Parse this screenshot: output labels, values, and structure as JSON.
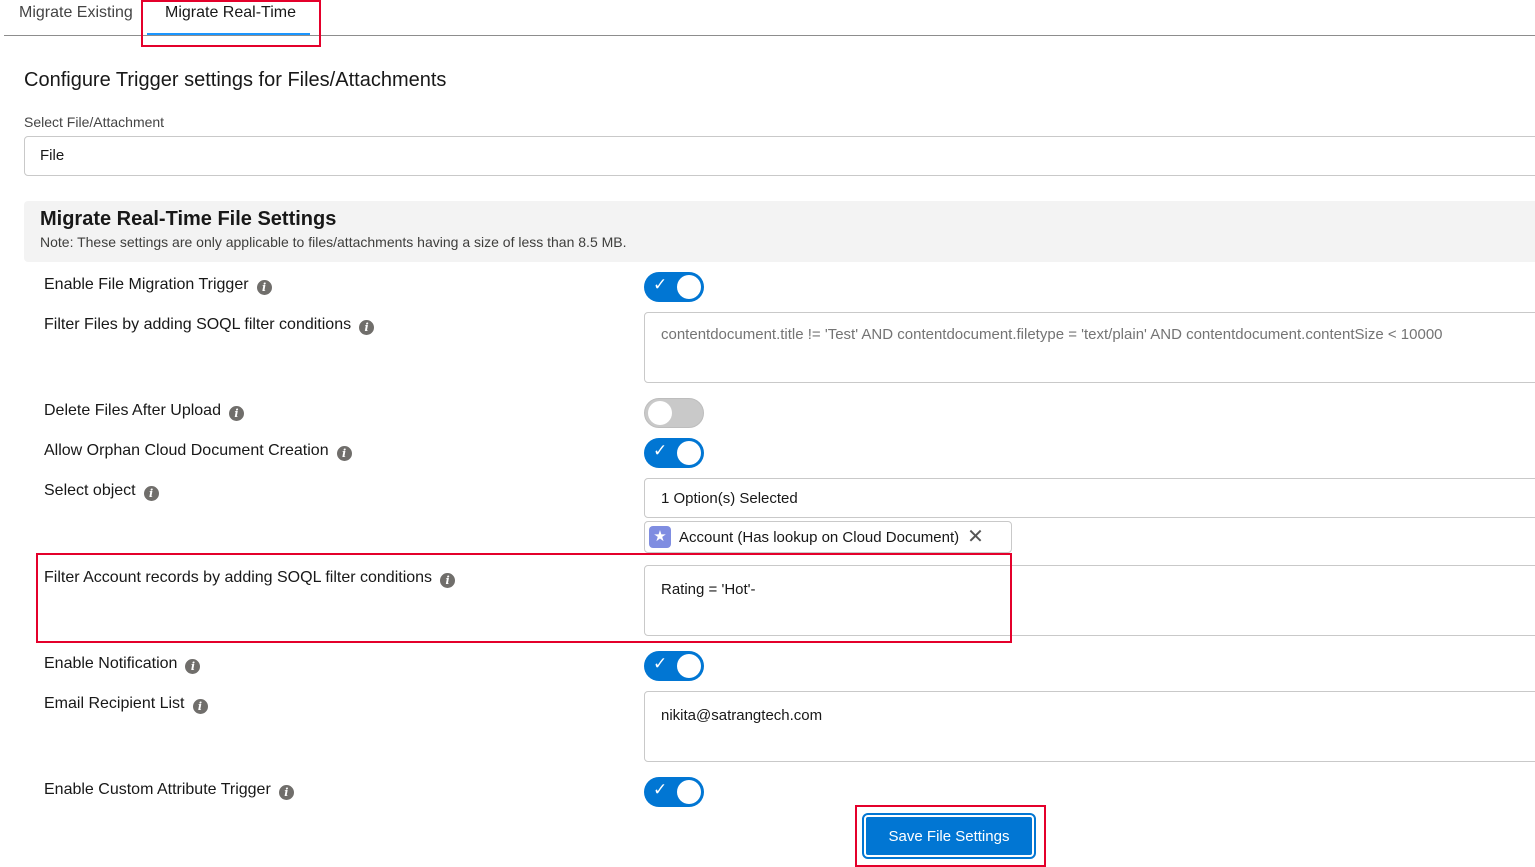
{
  "tabs": [
    {
      "label": "Migrate Existing",
      "active": false
    },
    {
      "label": "Migrate Real-Time",
      "active": true
    }
  ],
  "page_title": "Configure Trigger settings for Files/Attachments",
  "file_select": {
    "label": "Select File/Attachment",
    "value": "File"
  },
  "section": {
    "title": "Migrate Real-Time File Settings",
    "note": "Note: These settings are only applicable to files/attachments having a size of less than 8.5 MB."
  },
  "rows": {
    "enable_trigger": {
      "label": "Enable File Migration Trigger",
      "on": true
    },
    "filter_files": {
      "label": "Filter Files by adding SOQL filter conditions",
      "placeholder": "contentdocument.title != 'Test' AND contentdocument.filetype = 'text/plain' AND contentdocument.contentSize < 10000"
    },
    "delete_after": {
      "label": "Delete Files After Upload",
      "on": false
    },
    "allow_orphan": {
      "label": "Allow Orphan Cloud Document Creation",
      "on": true
    },
    "select_object": {
      "label": "Select object",
      "value": "1 Option(s) Selected",
      "selected_pill": "Account (Has lookup on Cloud Document)"
    },
    "filter_account": {
      "label": "Filter Account records by adding SOQL filter conditions",
      "value": "Rating = 'Hot'-"
    },
    "enable_notification": {
      "label": "Enable Notification",
      "on": true
    },
    "email_recipients": {
      "label": "Email Recipient List",
      "value": "nikita@satrangtech.com"
    },
    "enable_custom_attr": {
      "label": "Enable Custom Attribute Trigger",
      "on": true
    }
  },
  "info_glyph": "i",
  "check_glyph": "✓",
  "close_glyph": "✕",
  "star_glyph": "★",
  "save_button": "Save File Settings",
  "colors": {
    "brand": "#0176d3",
    "highlight": "#e4002b",
    "tab_active": "#1b96ff"
  }
}
